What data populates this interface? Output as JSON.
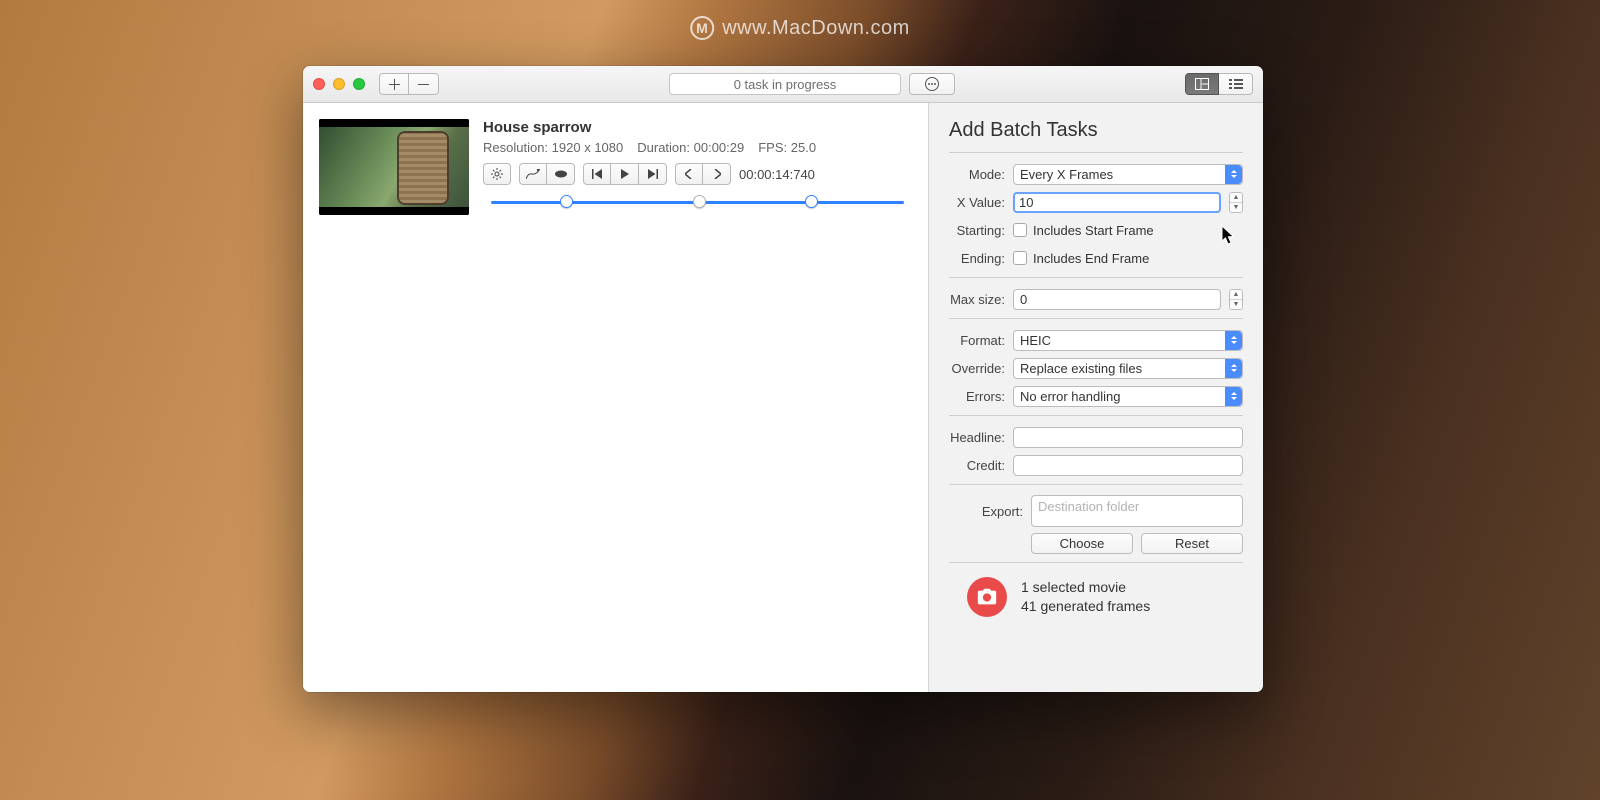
{
  "watermark": "www.MacDown.com",
  "toolbar": {
    "status": "0 task in progress"
  },
  "item": {
    "title": "House sparrow",
    "resolution_label": "Resolution:",
    "resolution_value": "1920 x 1080",
    "duration_label": "Duration:",
    "duration_value": "00:00:29",
    "fps_label": "FPS:",
    "fps_value": "25.0",
    "timecode": "00:00:14:740"
  },
  "panel": {
    "title": "Add Batch Tasks",
    "mode": {
      "label": "Mode:",
      "value": "Every X Frames"
    },
    "xvalue": {
      "label": "X Value:",
      "value": "10"
    },
    "starting": {
      "label": "Starting:",
      "checkbox": "Includes Start Frame"
    },
    "ending": {
      "label": "Ending:",
      "checkbox": "Includes End Frame"
    },
    "maxsize": {
      "label": "Max size:",
      "value": "0"
    },
    "format": {
      "label": "Format:",
      "value": "HEIC"
    },
    "override": {
      "label": "Override:",
      "value": "Replace existing files"
    },
    "errors": {
      "label": "Errors:",
      "value": "No error handling"
    },
    "headline": {
      "label": "Headline:",
      "value": ""
    },
    "credit": {
      "label": "Credit:",
      "value": ""
    },
    "export": {
      "label": "Export:",
      "placeholder": "Destination folder"
    },
    "choose": "Choose",
    "reset": "Reset",
    "summary1": "1 selected movie",
    "summary2": "41 generated frames"
  }
}
